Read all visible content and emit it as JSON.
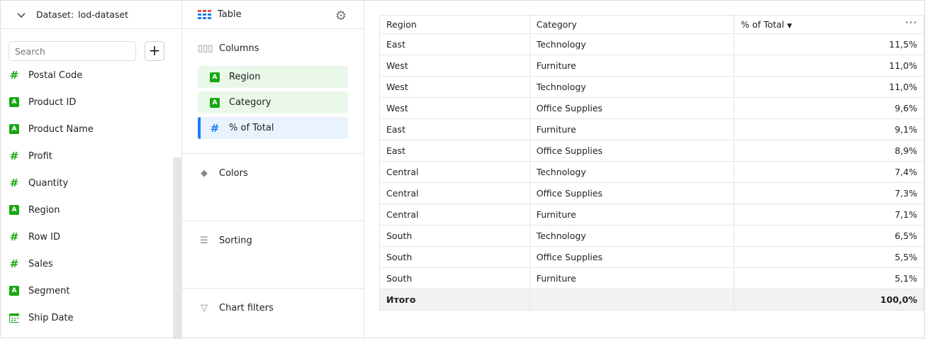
{
  "dataset": {
    "label": "Dataset:",
    "name": "lod-dataset"
  },
  "search": {
    "placeholder": "Search"
  },
  "add_label": "+",
  "fields": [
    {
      "name": "Postal Code",
      "type": "number"
    },
    {
      "name": "Product ID",
      "type": "string"
    },
    {
      "name": "Product Name",
      "type": "string"
    },
    {
      "name": "Profit",
      "type": "number"
    },
    {
      "name": "Quantity",
      "type": "number"
    },
    {
      "name": "Region",
      "type": "string"
    },
    {
      "name": "Row ID",
      "type": "number"
    },
    {
      "name": "Sales",
      "type": "number"
    },
    {
      "name": "Segment",
      "type": "string"
    },
    {
      "name": "Ship Date",
      "type": "date"
    }
  ],
  "viz": {
    "title": "Table",
    "icon": "table-icon"
  },
  "sections": {
    "columns": "Columns",
    "colors": "Colors",
    "sorting": "Sorting",
    "filters": "Chart filters"
  },
  "column_chips": [
    {
      "name": "Region",
      "type": "string"
    },
    {
      "name": "Category",
      "type": "string"
    },
    {
      "name": "% of Total",
      "type": "number"
    }
  ],
  "table": {
    "headers": [
      "Region",
      "Category",
      "% of Total"
    ],
    "more": "•••",
    "rows": [
      [
        "East",
        "Technology",
        "11,5%"
      ],
      [
        "West",
        "Furniture",
        "11,0%"
      ],
      [
        "West",
        "Technology",
        "11,0%"
      ],
      [
        "West",
        "Office Supplies",
        "9,6%"
      ],
      [
        "East",
        "Furniture",
        "9,1%"
      ],
      [
        "East",
        "Office Supplies",
        "8,9%"
      ],
      [
        "Central",
        "Technology",
        "7,4%"
      ],
      [
        "Central",
        "Office Supplies",
        "7,3%"
      ],
      [
        "Central",
        "Furniture",
        "7,1%"
      ],
      [
        "South",
        "Technology",
        "6,5%"
      ],
      [
        "South",
        "Office Supplies",
        "5,5%"
      ],
      [
        "South",
        "Furniture",
        "5,1%"
      ]
    ],
    "total": [
      "Итого",
      "",
      "100,0%"
    ]
  },
  "colors": {
    "string": "#18a812",
    "number_green": "#18a812",
    "number_blue": "#1a7ff0"
  }
}
